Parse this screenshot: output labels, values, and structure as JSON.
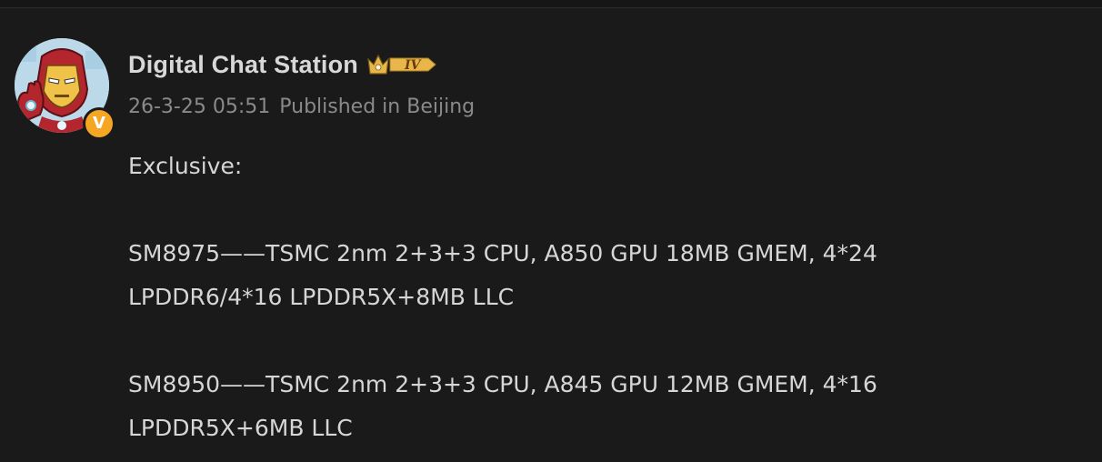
{
  "post": {
    "author": {
      "name": "Digital Chat Station",
      "avatar_icon": "iron-man-avatar-icon",
      "verified_icon": "verified-v-icon",
      "verified_text": "V",
      "member_level_text": "IV",
      "member_icon": "crown-level-badge-icon",
      "colors": {
        "verified": "#f5a623",
        "member_badge": "#e9b64a"
      }
    },
    "meta": {
      "time": "26-3-25 05:51",
      "location": "Published in Beijing"
    },
    "body": {
      "intro": "Exclusive:",
      "chip1_line1": "SM8975——TSMC 2nm 2+3+3 CPU, A850 GPU 18MB GMEM, 4*24",
      "chip1_line2": "LPDDR6/4*16 LPDDR5X+8MB LLC",
      "chip2_line1": "SM8950——TSMC 2nm 2+3+3 CPU, A845 GPU 12MB GMEM, 4*16",
      "chip2_line2": "LPDDR5X+6MB LLC"
    }
  }
}
